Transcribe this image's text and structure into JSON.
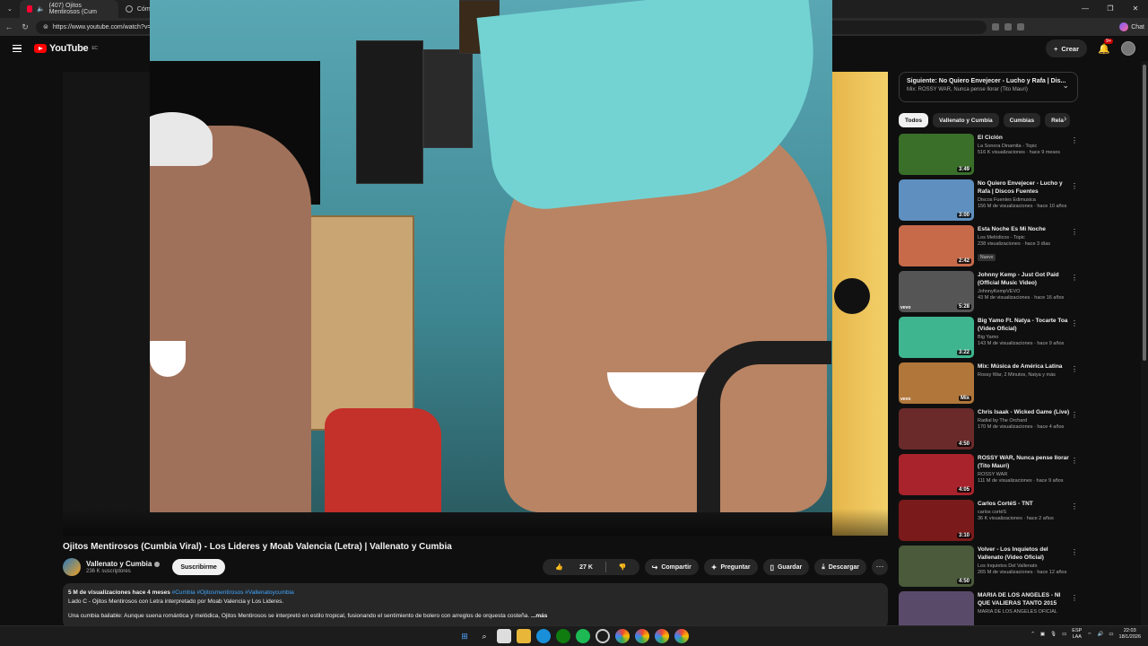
{
  "browser": {
    "tabs": [
      {
        "label": "(407) Ojitos Mentirosos (Cum"
      },
      {
        "label": "Cóm"
      }
    ],
    "url": "https://www.youtube.com/watch?v=",
    "chat_label": "Chat"
  },
  "yt": {
    "logo": "YouTube",
    "country": "EC",
    "create_label": "Crear",
    "notif_count": "9+"
  },
  "video": {
    "title": "Ojitos Mentirosos (Cumbia Viral) - Los Lideres y Moab Valencia (Letra) | Vallenato y Cumbia",
    "channel": "Vallenato y Cumbia",
    "subscribers": "236 K suscriptores",
    "subscribe_label": "Suscribirme",
    "likes": "27 K",
    "actions": {
      "share": "Compartir",
      "ask": "Preguntar",
      "save": "Guardar",
      "download": "Descargar"
    },
    "description": {
      "meta": "5 M de visualizaciones  hace 4 meses",
      "tags": "#Cumbia #Ojitosmentirosos #Vallenatoycumbia",
      "line1": "Lado C - Ojitos Mentirosos con Letra interpretado por Moab Valencia y Los Lideres.",
      "line2": "Una cumbia bailable: Aunque suena romántica y melódica, Ojitos Mentirosos se interpretó en estilo tropical, fusionando el sentimiento de bolero con arreglos de orquesta costeña.",
      "more": "...más"
    }
  },
  "sidebar": {
    "next_title": "Siguiente: No Quiero Envejecer - Lucho y Rafa | Dis...",
    "next_sub": "Mix: ROSSY WAR, Nunca pense llorar (Tito Mauri)",
    "chips": [
      "Todos",
      "Vallenato y Cumbia",
      "Cumbias",
      "Rela"
    ],
    "videos": [
      {
        "title": "El Ciclón",
        "channel": "La Sonora Dinamita - Topic",
        "meta": "516 K visualizaciones · hace 9 meses",
        "duration": "3:49",
        "color": "#3a6f2a"
      },
      {
        "title": "No Quiero Envejecer - Lucho y Rafa | Discos Fuentes",
        "channel": "Discos Fuentes Edimusica",
        "meta": "156 M de visualizaciones · hace 10 años",
        "duration": "3:00",
        "color": "#5f8fbf"
      },
      {
        "title": "Esta Noche Es Mi Noche",
        "channel": "Los Melódicos - Topic",
        "meta": "238 visualizaciones · hace 3 días",
        "badge": "Nuevo",
        "duration": "2:42",
        "color": "#c76a4a"
      },
      {
        "title": "Johnny Kemp - Just Got Paid (Official Music Video)",
        "channel": "JohnnyKempVEVO",
        "meta": "43 M de visualizaciones · hace 16 años",
        "duration": "5:28",
        "color": "#555555",
        "vevo": "vevo"
      },
      {
        "title": "Big Yamo Ft. Natya - Tocarte Toa (Video Oficial)",
        "channel": "Big Yamo",
        "meta": "143 M de visualizaciones · hace 9 años",
        "duration": "3:22",
        "color": "#3fb58f"
      },
      {
        "title": "Mix: Música de América Latina",
        "channel": "Rossy War, 2 Minutos, Natya y más",
        "meta": "",
        "duration": "Mix",
        "color": "#b0763a",
        "vevo": "vevo"
      },
      {
        "title": "Chris Isaak - Wicked Game (Live)",
        "channel": "Radial by The Orchard",
        "meta": "170 M de visualizaciones · hace 4 años",
        "duration": "4:50",
        "color": "#6a2a2a"
      },
      {
        "title": "ROSSY WAR, Nunca pense llorar (Tito Mauri)",
        "channel": "ROSSY WAR",
        "meta": "111 M de visualizaciones · hace 9 años",
        "duration": "4:05",
        "color": "#a8232c"
      },
      {
        "title": "Carlos CortéS - TNT",
        "channel": "carlos cortéS",
        "meta": "36 K visualizaciones · hace 2 años",
        "duration": "3:10",
        "color": "#7a1a1a"
      },
      {
        "title": "Volver - Los Inquietos del Vallenato (Video Oficial)",
        "channel": "Los Inquietos Del Vallenato",
        "meta": "265 M de visualizaciones · hace 12 años",
        "duration": "4:50",
        "color": "#4a5a3a"
      },
      {
        "title": "MARIA DE LOS ANGELES - NI QUE VALIERAS TANTO 2015",
        "channel": "MARIA DE LOS ANGELES OFICIAL",
        "meta": "",
        "duration": "",
        "color": "#5a4a6a"
      }
    ]
  },
  "taskbar": {
    "lang1": "ESP",
    "lang2": "LAA",
    "time": "22:03",
    "date": "18/1/2026"
  }
}
